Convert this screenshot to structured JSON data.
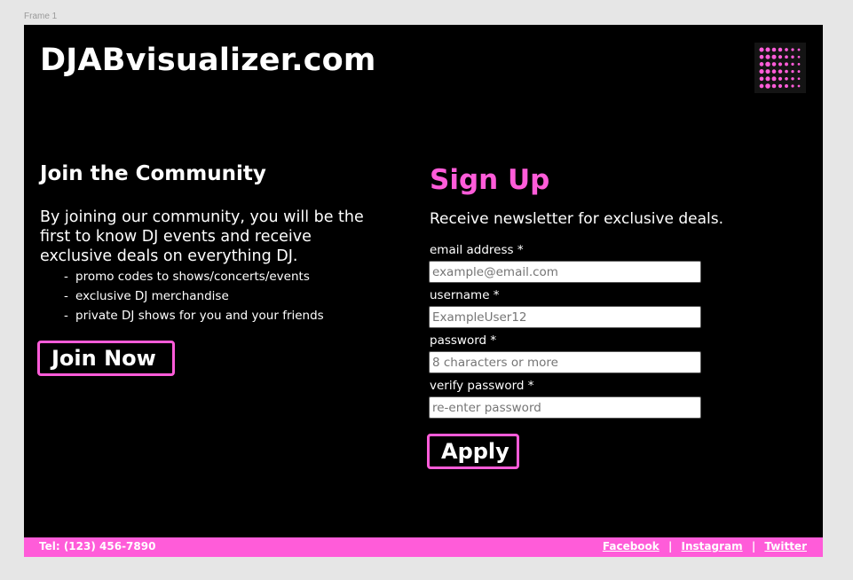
{
  "frame": {
    "label": "Frame 1"
  },
  "header": {
    "brand": "DJABvisualizer.com",
    "logo_icon": "dot-grid-logo-icon"
  },
  "community": {
    "title": "Join the Community",
    "description": "By joining our community, you will be the first to know DJ events and receive exclusive deals on everything DJ.",
    "perks": [
      "promo codes to shows/concerts/events",
      "exclusive DJ merchandise",
      "private DJ shows for you and your friends"
    ],
    "join_button": "Join Now"
  },
  "signup": {
    "title": "Sign Up",
    "subtitle": "Receive newsletter for exclusive deals.",
    "fields": [
      {
        "label": "email address *",
        "placeholder": "example@email.com"
      },
      {
        "label": "username *",
        "placeholder": "ExampleUser12"
      },
      {
        "label": "password *",
        "placeholder": "8 characters or more"
      },
      {
        "label": "verify password *",
        "placeholder": "re-enter password"
      }
    ],
    "apply_button": "Apply"
  },
  "footer": {
    "phone": "Tel: (123) 456-7890",
    "links": [
      "Facebook",
      "Instagram",
      "Twitter"
    ],
    "separator": "|"
  },
  "colors": {
    "accent": "#ff5cd9",
    "background": "#000000",
    "canvas": "#e6e6e6"
  }
}
